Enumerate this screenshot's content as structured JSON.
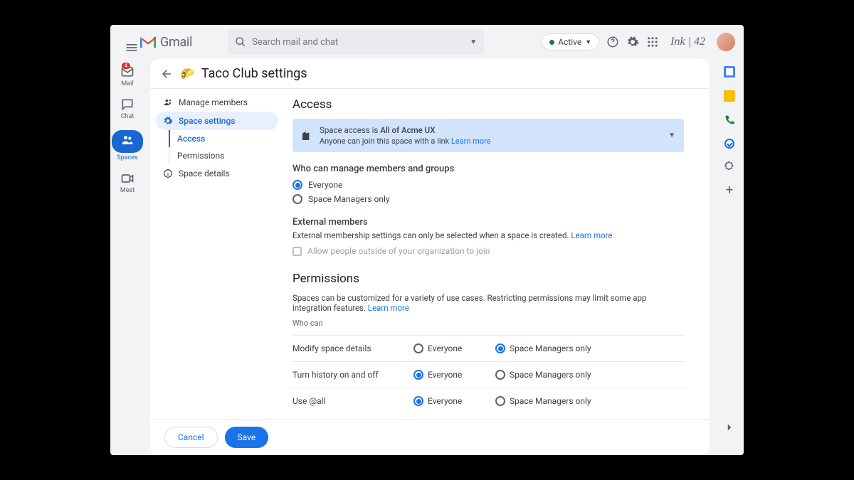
{
  "header": {
    "gmail_text": "Gmail",
    "search_placeholder": "Search mail and chat",
    "status_label": "Active",
    "brand_text": "Ink | 42"
  },
  "leftrail": {
    "items": [
      {
        "label": "Mail",
        "badge": "4"
      },
      {
        "label": "Chat"
      },
      {
        "label": "Spaces"
      },
      {
        "label": "Meet"
      }
    ]
  },
  "page": {
    "title": "Taco Club settings"
  },
  "sidebar": {
    "items": [
      {
        "label": "Manage members"
      },
      {
        "label": "Space settings"
      },
      {
        "label": "Space details"
      }
    ],
    "sub_items": [
      {
        "label": "Access"
      },
      {
        "label": "Permissions"
      }
    ]
  },
  "access": {
    "heading": "Access",
    "banner_line1_prefix": "Space access is ",
    "banner_line1_bold": "All of Acme UX",
    "banner_line2": "Anyone can join this space with a link ",
    "banner_learn": "Learn more",
    "who_manage_h": "Who can manage members and groups",
    "opt_everyone": "Everyone",
    "opt_managers": "Space Managers only",
    "external_h": "External members",
    "external_desc": "External membership settings can only be selected when a space is created. ",
    "external_learn": "Learn more",
    "external_checkbox": "Allow people outside of your organization to join"
  },
  "permissions": {
    "heading": "Permissions",
    "desc": "Spaces can be customized for a variety of use cases. Restricting permissions may limit some app integration features. ",
    "learn": "Learn more",
    "who_can": "Who can",
    "rows": [
      {
        "label": "Modify space details",
        "selected": "managers"
      },
      {
        "label": "Turn history on and off",
        "selected": "everyone"
      },
      {
        "label": "Use @all",
        "selected": "everyone"
      }
    ],
    "opt_everyone": "Everyone",
    "opt_managers": "Space Managers only"
  },
  "footer": {
    "cancel": "Cancel",
    "save": "Save"
  }
}
